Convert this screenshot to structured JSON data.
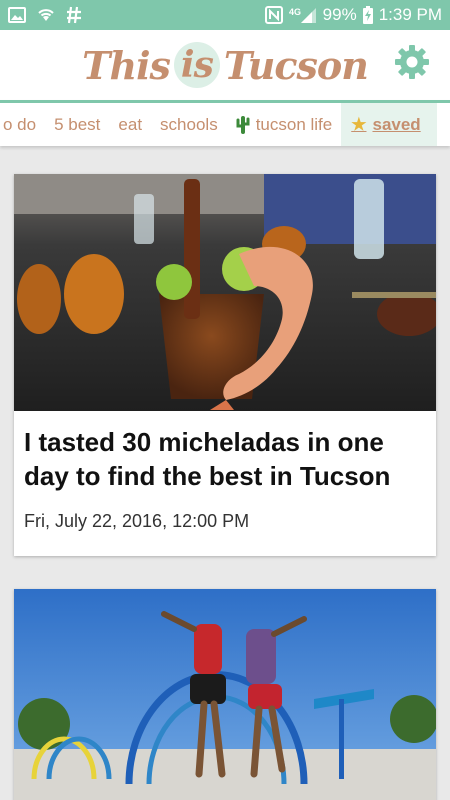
{
  "status_bar": {
    "left_icons": [
      "image-icon",
      "wifi-icon",
      "hash-icon"
    ],
    "battery_percent": "99%",
    "time": "1:39 PM",
    "network_label": "4G",
    "nfc_label": "N",
    "bg_color": "#7fc7ab"
  },
  "header": {
    "logo_part_1": "This",
    "logo_part_2": "is",
    "logo_part_3": "Tucson",
    "settings_icon": "gear-icon",
    "brand_color": "#c58f6f",
    "accent_color": "#7fc7ab"
  },
  "nav": {
    "tabs": [
      {
        "label": "o do"
      },
      {
        "label": "5 best"
      },
      {
        "label": "eat"
      },
      {
        "label": "schools"
      },
      {
        "label": "tucson life",
        "icon": "cactus-icon"
      },
      {
        "label": "saved",
        "icon": "star-icon",
        "active": true
      }
    ]
  },
  "feed": {
    "articles": [
      {
        "title": "I tasted 30 micheladas in one day to find the best in Tucson",
        "date": "Fri, July 22, 2016, 12:00 PM",
        "image": "michelada-photo"
      },
      {
        "image": "splash-pad-photo"
      }
    ]
  }
}
